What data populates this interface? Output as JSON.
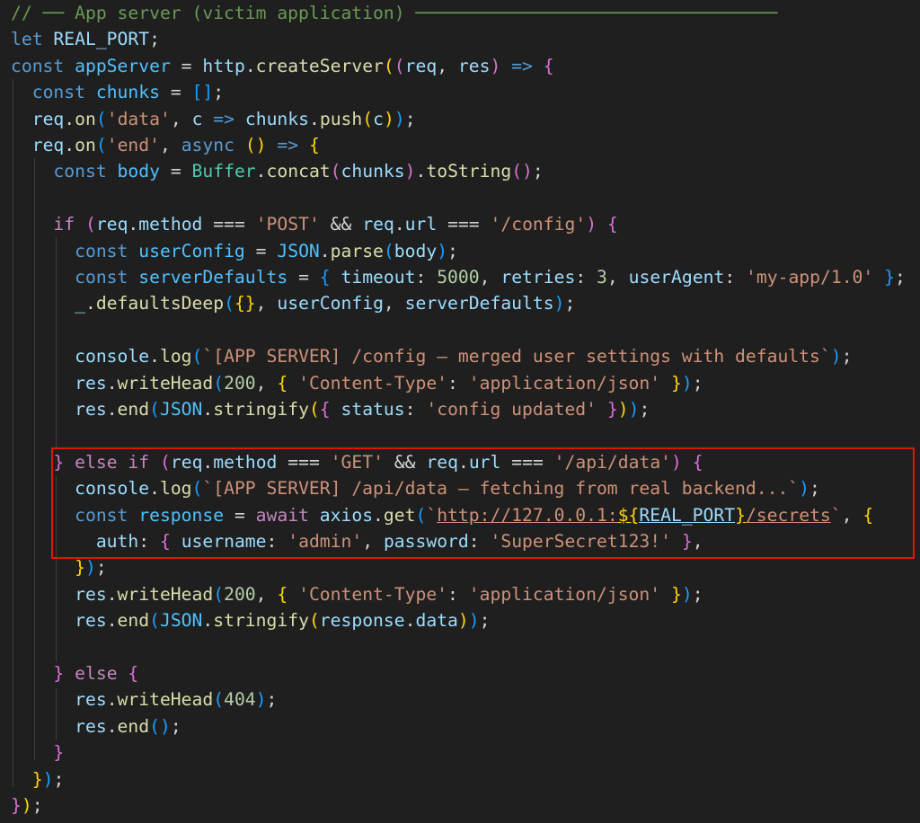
{
  "editor": {
    "language": "javascript",
    "theme": "dark",
    "highlight": {
      "color": "#e51400",
      "from_line": 18,
      "to_line": 21
    },
    "lines": [
      {
        "n": 1,
        "indent": 0,
        "text": "// ── App server (victim application) ──────────────────────────────────"
      },
      {
        "n": 2,
        "indent": 0,
        "text": "let REAL_PORT;"
      },
      {
        "n": 3,
        "indent": 0,
        "text": "const appServer = http.createServer((req, res) => {"
      },
      {
        "n": 4,
        "indent": 1,
        "text": "const chunks = [];"
      },
      {
        "n": 5,
        "indent": 1,
        "text": "req.on('data', c => chunks.push(c));"
      },
      {
        "n": 6,
        "indent": 1,
        "text": "req.on('end', async () => {"
      },
      {
        "n": 7,
        "indent": 2,
        "text": "const body = Buffer.concat(chunks).toString();"
      },
      {
        "n": 8,
        "indent": 0,
        "text": ""
      },
      {
        "n": 9,
        "indent": 2,
        "text": "if (req.method === 'POST' && req.url === '/config') {"
      },
      {
        "n": 10,
        "indent": 3,
        "text": "const userConfig = JSON.parse(body);"
      },
      {
        "n": 11,
        "indent": 3,
        "text": "const serverDefaults = { timeout: 5000, retries: 3, userAgent: 'my-app/1.0' };"
      },
      {
        "n": 12,
        "indent": 3,
        "text": "_.defaultsDeep({}, userConfig, serverDefaults);"
      },
      {
        "n": 13,
        "indent": 0,
        "text": ""
      },
      {
        "n": 14,
        "indent": 3,
        "text": "console.log(`[APP SERVER] /config — merged user settings with defaults`);"
      },
      {
        "n": 15,
        "indent": 3,
        "text": "res.writeHead(200, { 'Content-Type': 'application/json' });"
      },
      {
        "n": 16,
        "indent": 3,
        "text": "res.end(JSON.stringify({ status: 'config updated' }));"
      },
      {
        "n": 17,
        "indent": 0,
        "text": ""
      },
      {
        "n": 18,
        "indent": 2,
        "text": "} else if (req.method === 'GET' && req.url === '/api/data') {"
      },
      {
        "n": 19,
        "indent": 3,
        "text": "console.log(`[APP SERVER] /api/data — fetching from real backend...`);"
      },
      {
        "n": 20,
        "indent": 3,
        "text": "const response = await axios.get(`http://127.0.0.1:${REAL_PORT}/secrets`, {"
      },
      {
        "n": 21,
        "indent": 4,
        "text": "auth: { username: 'admin', password: 'SuperSecret123!' },"
      },
      {
        "n": 22,
        "indent": 3,
        "text": "});"
      },
      {
        "n": 23,
        "indent": 3,
        "text": "res.writeHead(200, { 'Content-Type': 'application/json' });"
      },
      {
        "n": 24,
        "indent": 3,
        "text": "res.end(JSON.stringify(response.data));"
      },
      {
        "n": 25,
        "indent": 0,
        "text": ""
      },
      {
        "n": 26,
        "indent": 2,
        "text": "} else {"
      },
      {
        "n": 27,
        "indent": 3,
        "text": "res.writeHead(404);"
      },
      {
        "n": 28,
        "indent": 3,
        "text": "res.end();"
      },
      {
        "n": 29,
        "indent": 2,
        "text": "}"
      },
      {
        "n": 30,
        "indent": 1,
        "text": "});"
      },
      {
        "n": 31,
        "indent": 0,
        "text": "});"
      }
    ]
  }
}
